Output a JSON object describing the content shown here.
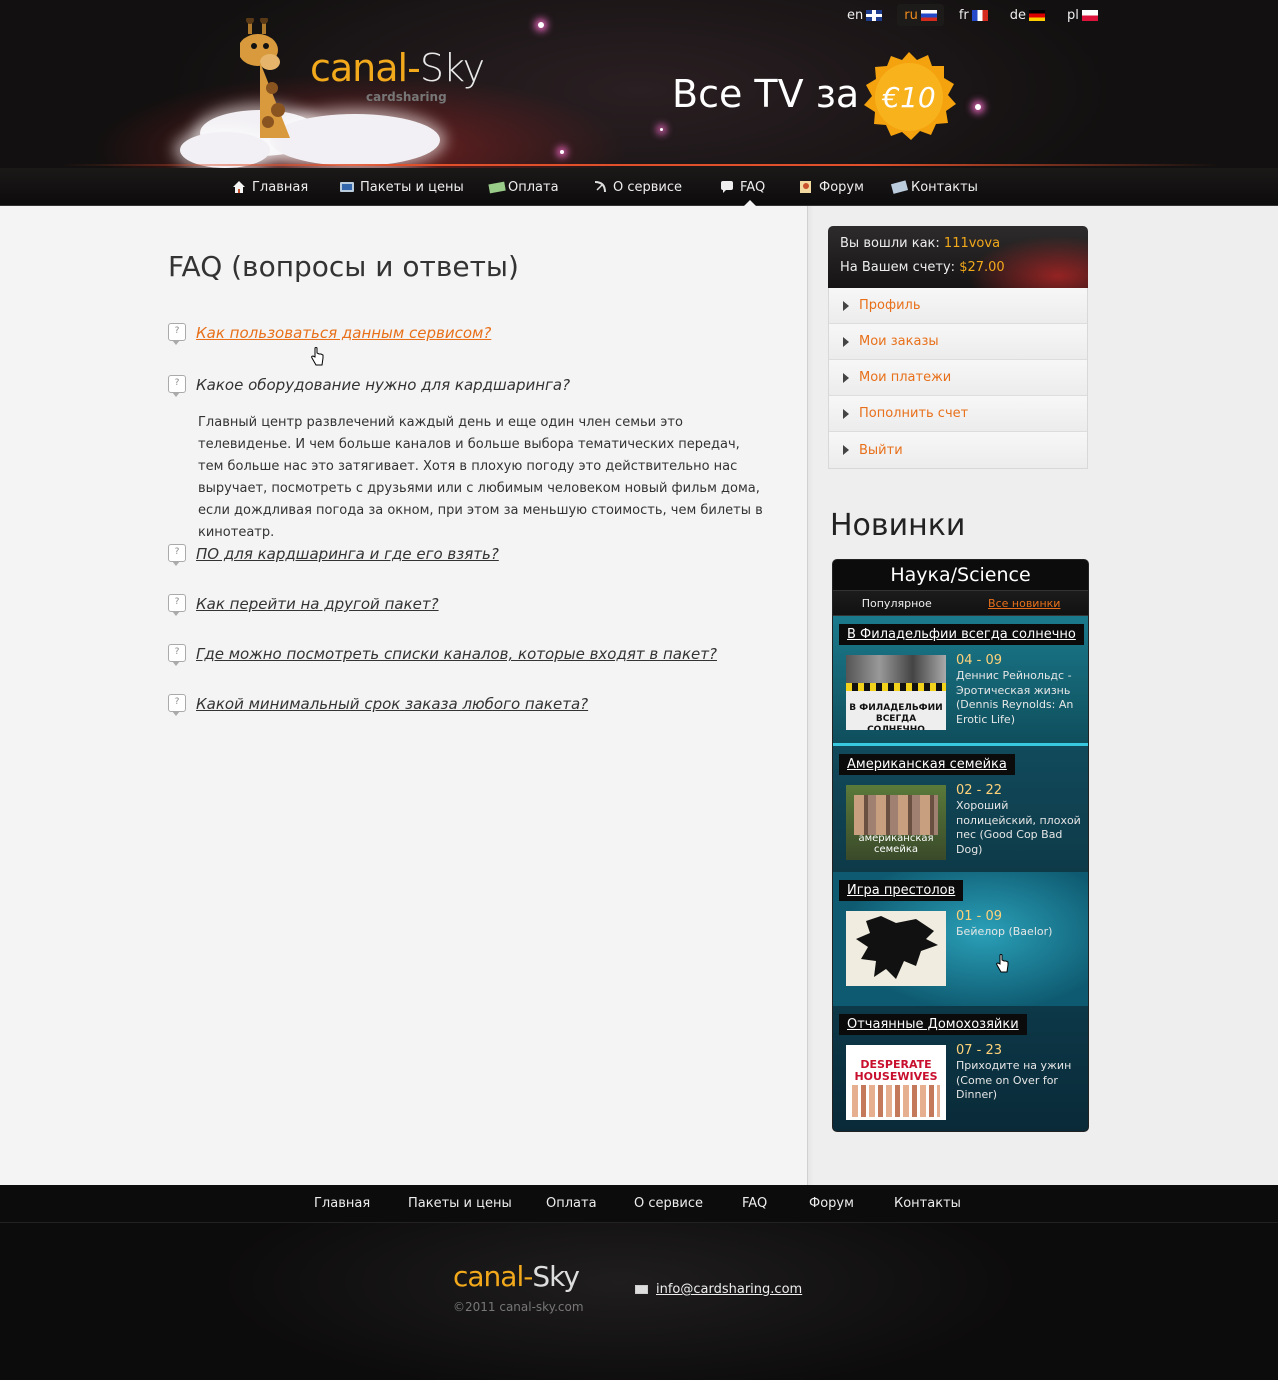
{
  "header": {
    "logo_canal": "canal-",
    "logo_sky": "Sky",
    "logo_sub": "cardsharing",
    "promo_text": "Все TV за",
    "promo_badge": "€10",
    "languages": [
      {
        "code": "en",
        "active": false
      },
      {
        "code": "ru",
        "active": true
      },
      {
        "code": "fr",
        "active": false
      },
      {
        "code": "de",
        "active": false
      },
      {
        "code": "pl",
        "active": false
      }
    ]
  },
  "nav": {
    "items": [
      {
        "label": "Главная",
        "icon": "home-icon"
      },
      {
        "label": "Пакеты и цены",
        "icon": "tv-icon"
      },
      {
        "label": "Оплата",
        "icon": "money-icon"
      },
      {
        "label": "О сервисе",
        "icon": "satellite-icon"
      },
      {
        "label": "FAQ",
        "icon": "faq-icon",
        "active": true
      },
      {
        "label": "Форум",
        "icon": "forum-icon"
      },
      {
        "label": "Контакты",
        "icon": "contacts-icon"
      }
    ]
  },
  "main": {
    "title": "FAQ (вопросы и ответы)",
    "faq": [
      {
        "question": "Как пользоваться данным сервисом?",
        "state": "hover"
      },
      {
        "question": "Какое оборудование нужно для кардшаринга?",
        "state": "open"
      },
      {
        "question": "ПО для кардшаринга и где его взять?"
      },
      {
        "question": "Как перейти на другой пакет?"
      },
      {
        "question": "Где можно посмотреть списки каналов, которые входят в пакет?"
      },
      {
        "question": "Какой минимальный срок заказа любого пакета?"
      }
    ],
    "answer": "Главный центр развлечений каждый день и еще один член семьи это телевиденье. И чем больше каналов и больше выбора тематических передач, тем больше нас это затягивает. Хотя в плохую погоду это действительно нас выручает, посмотреть с друзьями или с любимым человеком новый фильм дома, если дождливая погода за окном, при этом за меньшую стоимость, чем билеты в кинотеатр."
  },
  "sidebar": {
    "logged_in_label": "Вы вошли как:",
    "username": "111vova",
    "balance_label": "На Вашем счету:",
    "balance": "$27.00",
    "menu": [
      "Профиль",
      "Мои заказы",
      "Мои платежи",
      "Пополнить счет",
      "Выйти"
    ],
    "new_title": "Новинки",
    "widget": {
      "channel": "Наука/Science",
      "tabs": [
        "Популярное",
        "Все новинки"
      ],
      "shows": [
        {
          "title": "В Филадельфии всегда солнечно",
          "episode": "04 - 09",
          "name": "Деннис Рейнольдс - Эротическая жизнь (Dennis Reynolds: An Erotic Life)",
          "poster_text": "В ФИЛАДЕЛЬФИИ ВСЕГДА СОЛНЕЧНО"
        },
        {
          "title": "Американская семейка",
          "episode": "02 - 22",
          "name": "Хороший полицейский, плохой пес (Good Cop Bad Dog)",
          "poster_text": "американская семейка"
        },
        {
          "title": "Игра престолов",
          "episode": "01 - 09",
          "name": "Бейелор (Baelor)"
        },
        {
          "title": "Отчаянные Домохозяйки",
          "episode": "07 - 23",
          "name": "Приходите на ужин (Come on Over for Dinner)",
          "poster_text": "DESPERATE HOUSEWIVES"
        }
      ]
    }
  },
  "footer": {
    "nav": [
      "Главная",
      "Пакеты и цены",
      "Оплата",
      "О сервисе",
      "FAQ",
      "Форум",
      "Контакты"
    ],
    "logo_canal": "canal-",
    "logo_sky": "Sky",
    "copyright": "©2011 canal-sky.com",
    "email": "info@cardsharing.com"
  },
  "colors": {
    "accent": "#e8701a",
    "gold": "#f2a91b",
    "dark": "#0d0c0c"
  }
}
